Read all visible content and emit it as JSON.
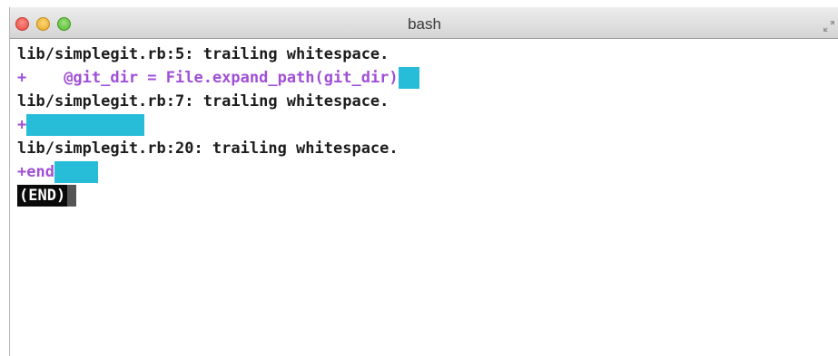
{
  "window": {
    "title": "bash"
  },
  "terminal": {
    "lines": [
      {
        "text": "lib/simplegit.rb:5: trailing whitespace."
      },
      {
        "plus": "+",
        "code": "    @git_dir = File.expand_path(git_dir)"
      },
      {
        "text": "lib/simplegit.rb:7: trailing whitespace."
      },
      {
        "plus": "+"
      },
      {
        "text": "lib/simplegit.rb:20: trailing whitespace."
      },
      {
        "code": "+end"
      }
    ],
    "pager_prompt": "(END)"
  },
  "colors": {
    "added_text": "#a04fd6",
    "whitespace_highlight": "#27bdd8",
    "pager_background": "#0a0a0a"
  },
  "icons": {
    "titlebar_right": "fullscreen-arrows-icon"
  }
}
